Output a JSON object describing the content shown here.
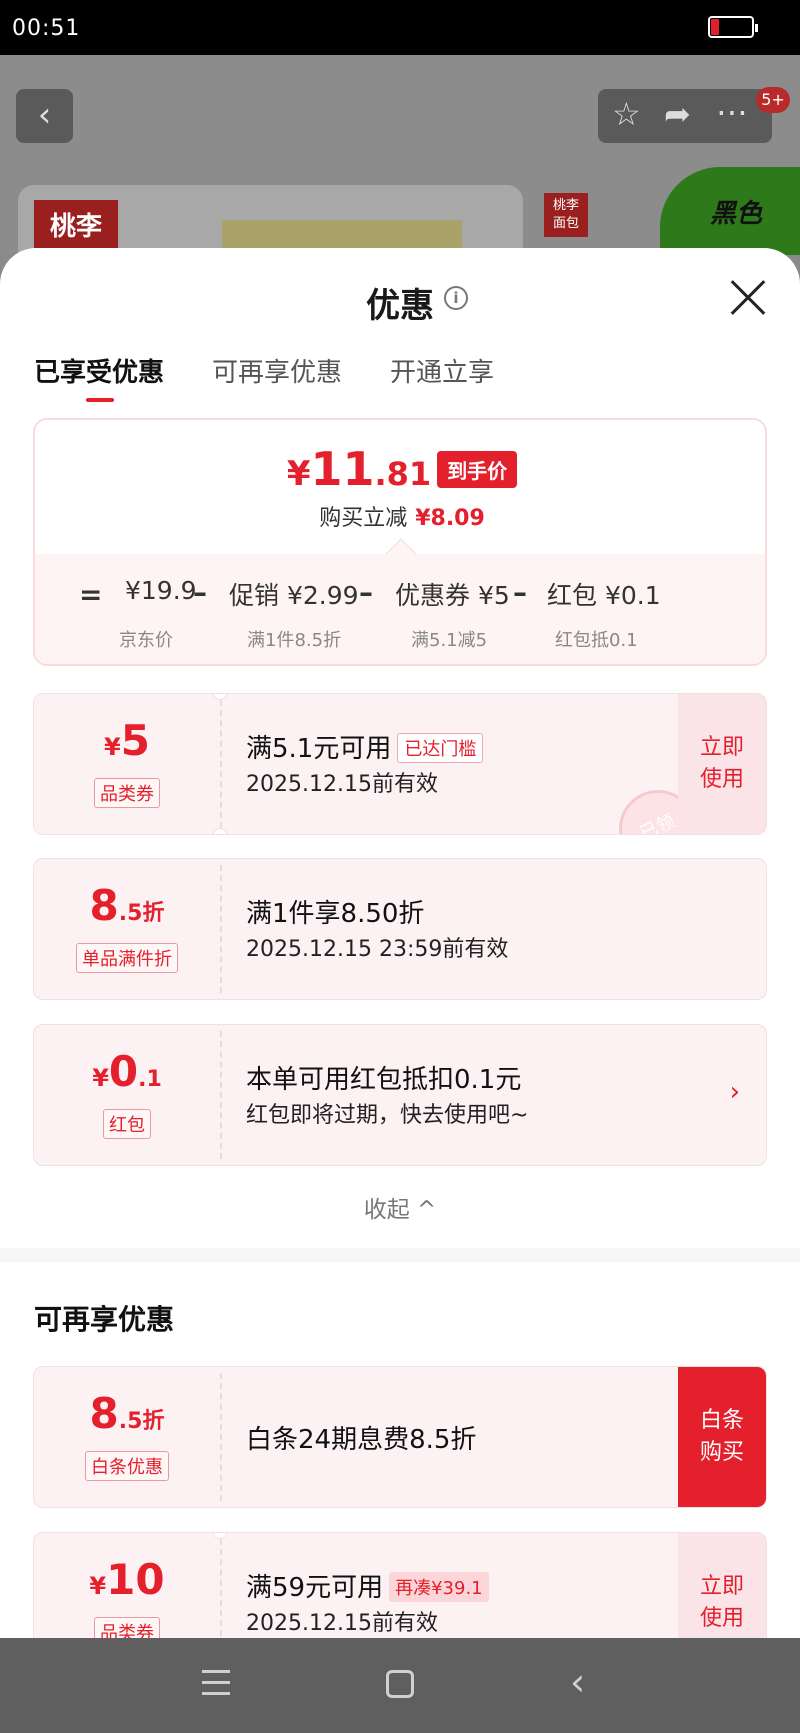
{
  "status_bar": {
    "time": "00:51"
  },
  "background": {
    "back": "‹",
    "cart_badge": "5+",
    "brand_logo": "桃李",
    "brand_logo_small": "桃李\n面包",
    "product_text": "黑色"
  },
  "sheet": {
    "title": "优惠",
    "tabs": [
      "已享受优惠",
      "可再享优惠",
      "开通立享"
    ],
    "active_tab": 0
  },
  "summary": {
    "currency": "¥",
    "price_int": "11",
    "price_dec": ".81",
    "price_tag": "到手价",
    "reduce_label": "购买立减",
    "reduce_value": "¥8.09",
    "calc": {
      "eq": "=",
      "minus": "–",
      "jd_price": "¥19.9",
      "jd_price_label": "京东价",
      "promo": "促销 ¥2.99",
      "promo_label": "满1件8.5折",
      "coupon": "优惠券 ¥5",
      "coupon_label": "满5.1减5",
      "redpacket": "红包 ¥0.1",
      "redpacket_label": "红包抵0.1"
    }
  },
  "enjoyed": [
    {
      "symbol": "¥",
      "big": "5",
      "tail": "",
      "type": "品类券",
      "main": "满5.1元可用",
      "tag": "已达门槛",
      "sub": "2025.12.15前有效",
      "action": "立即\n使用",
      "stamp": "已领"
    },
    {
      "symbol": "",
      "big": "8",
      "tail": ".5折",
      "type": "单品满件折",
      "main": "满1件享8.50折",
      "sub": "2025.12.15 23:59前有效"
    },
    {
      "symbol": "¥",
      "big": "0",
      "tail": ".1",
      "type": "红包",
      "main": "本单可用红包抵扣0.1元",
      "sub": "红包即将过期，快去使用吧~",
      "chevron": "›"
    }
  ],
  "collapse_label": "收起 ^",
  "more_section": {
    "title": "可再享优惠",
    "items": [
      {
        "symbol": "",
        "big": "8",
        "tail": ".5折",
        "type": "白条优惠",
        "main": "白条24期息费8.5折",
        "action": "白条\n购买"
      },
      {
        "symbol": "¥",
        "big": "10",
        "tail": "",
        "type": "品类券",
        "main": "满59元可用",
        "tag": "再凑¥39.1",
        "sub": "2025.12.15前有效",
        "action": "立即\n使用"
      }
    ]
  },
  "colors": {
    "accent": "#e3202c",
    "coupon_bg": "#fdf2f3",
    "tag_bg": "#fbd5d8"
  },
  "icons": [
    "back-icon",
    "star-icon",
    "share-icon",
    "more-icon",
    "info-icon",
    "close-icon",
    "chevron-right-icon",
    "chevron-up-icon",
    "menu-icon",
    "home-icon",
    "back-nav-icon"
  ]
}
